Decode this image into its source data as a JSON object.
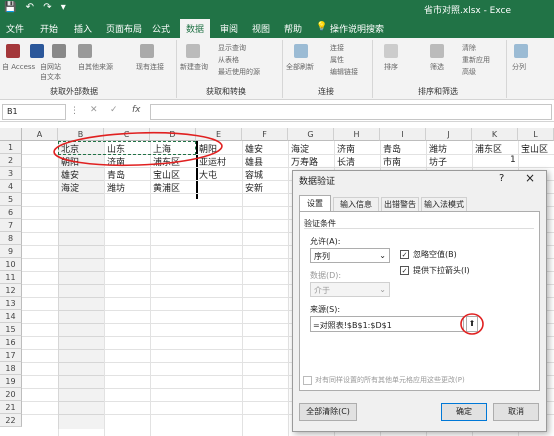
{
  "titlebar": {
    "file_name": "省市对照.xlsx - Exce"
  },
  "tabs": [
    "文件",
    "开始",
    "插入",
    "页面布局",
    "公式",
    "数据",
    "审阅",
    "视图",
    "帮助",
    "操作说明搜索"
  ],
  "ribbon": {
    "ext_items": [
      "自 Access",
      "自网站",
      "自文本",
      "自其他来源",
      "现有连接"
    ],
    "new_query": "新建查询",
    "query_items": [
      "显示查询",
      "从表格",
      "最近使用的源"
    ],
    "refresh_all": "全部刷新",
    "conn_items": [
      "连接",
      "属性",
      "编辑链接"
    ],
    "sort_items": [
      "排序",
      "筛选"
    ],
    "filter_items": [
      "清除",
      "重新应用",
      "高级"
    ],
    "split": "分列",
    "groups": [
      "获取外部数据",
      "获取和转换",
      "连接",
      "排序和筛选"
    ]
  },
  "formula_bar": {
    "name_box": "B1",
    "fx": "fx"
  },
  "columns": [
    "A",
    "B",
    "C",
    "D",
    "E",
    "F",
    "G",
    "H",
    "I",
    "J",
    "K",
    "L"
  ],
  "rows": [
    "1",
    "2",
    "3",
    "4",
    "5",
    "6",
    "7",
    "8",
    "9",
    "10",
    "11",
    "12",
    "13",
    "14",
    "15",
    "16",
    "17",
    "18",
    "19",
    "20",
    "21",
    "22"
  ],
  "cells": {
    "row1": [
      "北京",
      "山东",
      "上海",
      "朝阳",
      "雄安",
      "海淀",
      "济南",
      "青岛",
      "潍坊",
      "浦东区",
      "宝山区"
    ],
    "row2": [
      "朝阳",
      "济南",
      "浦东区",
      "亚运村",
      "雄县",
      "万寿路",
      "长清",
      "市南",
      "坊子",
      "1"
    ],
    "row3": [
      "雄安",
      "青岛",
      "宝山区",
      "大屯",
      "容城"
    ],
    "row4": [
      "海淀",
      "潍坊",
      "黄浦区",
      "",
      "安新"
    ]
  },
  "dialog": {
    "title": "数据验证",
    "help": "?",
    "close": "×",
    "tabs": [
      "设置",
      "输入信息",
      "出错警告",
      "输入法模式"
    ],
    "criteria_label": "验证条件",
    "allow_label": "允许(A):",
    "allow_value": "序列",
    "ignore_blank": "忽略空值(B)",
    "dropdown": "提供下拉箭头(I)",
    "data_label": "数据(D):",
    "data_value": "介于",
    "source_label": "来源(S):",
    "source_value": "=对照表!$B$1:$D$1",
    "apply_all": "对有同样设置的所有其他单元格应用这些更改(P)",
    "clear_all": "全部清除(C)",
    "ok": "确定",
    "cancel": "取消"
  }
}
